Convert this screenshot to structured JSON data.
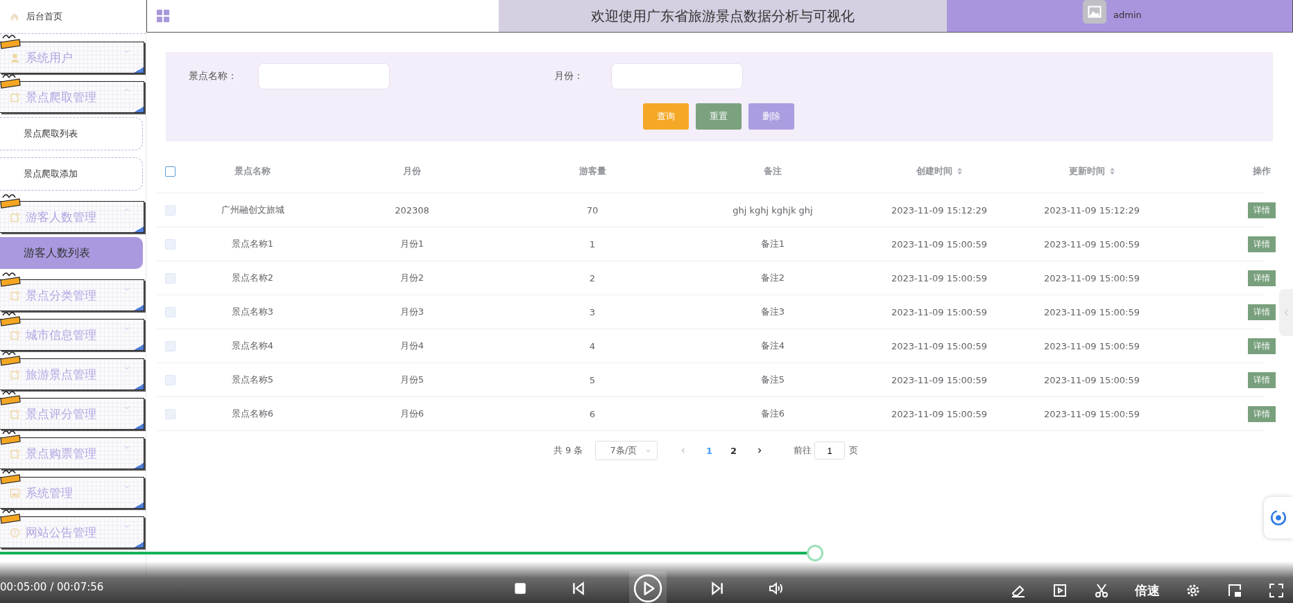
{
  "header": {
    "title": "欢迎使用广东省旅游景点数据分析与可视化",
    "user": "admin"
  },
  "sidebar": {
    "home": "后台首页",
    "groups": [
      {
        "label": "系统用户",
        "kind": "user",
        "expanded": false
      },
      {
        "label": "景点爬取管理",
        "kind": "document",
        "expanded": true,
        "children": [
          {
            "label": "景点爬取列表",
            "selected": false
          },
          {
            "label": "景点爬取添加",
            "selected": false
          }
        ]
      },
      {
        "label": "游客人数管理",
        "kind": "document",
        "expanded": true,
        "children": [
          {
            "label": "游客人数列表",
            "selected": true
          }
        ]
      },
      {
        "label": "景点分类管理",
        "kind": "document",
        "expanded": false
      },
      {
        "label": "城市信息管理",
        "kind": "document",
        "expanded": false
      },
      {
        "label": "旅游景点管理",
        "kind": "document",
        "expanded": false
      },
      {
        "label": "景点评分管理",
        "kind": "document",
        "expanded": false
      },
      {
        "label": "景点购票管理",
        "kind": "document",
        "expanded": false
      },
      {
        "label": "系统管理",
        "kind": "picture",
        "expanded": false
      },
      {
        "label": "网站公告管理",
        "kind": "info",
        "expanded": false
      }
    ]
  },
  "search": {
    "fields": [
      {
        "label": "景点名称："
      },
      {
        "label": "月份："
      }
    ],
    "buttons": [
      {
        "label": "查询",
        "kind": "query"
      },
      {
        "label": "重置",
        "kind": "reset"
      },
      {
        "label": "删除",
        "kind": "delete"
      }
    ]
  },
  "table": {
    "select_all": {
      "checked": false
    },
    "columns": [
      {
        "label": "景点名称",
        "sortable": false
      },
      {
        "label": "月份",
        "sortable": false
      },
      {
        "label": "游客量",
        "sortable": false
      },
      {
        "label": "备注",
        "sortable": false
      },
      {
        "label": "创建时间",
        "sortable": true
      },
      {
        "label": "更新时间",
        "sortable": true
      },
      {
        "label": "操作",
        "sortable": false
      }
    ],
    "rows": [
      {
        "checked": false,
        "cells": [
          "广州融创文旅城",
          "202308",
          "70",
          "ghj kghj kghjk ghj",
          "2023-11-09 15:12:29",
          "2023-11-09 15:12:29"
        ],
        "action": "详情"
      },
      {
        "checked": false,
        "cells": [
          "景点名称1",
          "月份1",
          "1",
          "备注1",
          "2023-11-09 15:00:59",
          "2023-11-09 15:00:59"
        ],
        "action": "详情"
      },
      {
        "checked": false,
        "cells": [
          "景点名称2",
          "月份2",
          "2",
          "备注2",
          "2023-11-09 15:00:59",
          "2023-11-09 15:00:59"
        ],
        "action": "详情"
      },
      {
        "checked": false,
        "cells": [
          "景点名称3",
          "月份3",
          "3",
          "备注3",
          "2023-11-09 15:00:59",
          "2023-11-09 15:00:59"
        ],
        "action": "详情"
      },
      {
        "checked": false,
        "cells": [
          "景点名称4",
          "月份4",
          "4",
          "备注4",
          "2023-11-09 15:00:59",
          "2023-11-09 15:00:59"
        ],
        "action": "详情"
      },
      {
        "checked": false,
        "cells": [
          "景点名称5",
          "月份5",
          "5",
          "备注5",
          "2023-11-09 15:00:59",
          "2023-11-09 15:00:59"
        ],
        "action": "详情"
      },
      {
        "checked": false,
        "cells": [
          "景点名称6",
          "月份6",
          "6",
          "备注6",
          "2023-11-09 15:00:59",
          "2023-11-09 15:00:59"
        ],
        "action": "详情"
      }
    ]
  },
  "pagination": {
    "total": "共 9 条",
    "page_size": "7条/页",
    "pages": [
      {
        "label": "1",
        "selected": true
      },
      {
        "label": "2",
        "selected": false
      }
    ],
    "goto_label": "前往",
    "goto_value": "1",
    "page_unit": "页"
  },
  "player": {
    "time": "00:05:00 / 00:07:56",
    "level": 0.63,
    "speed": "倍速"
  }
}
